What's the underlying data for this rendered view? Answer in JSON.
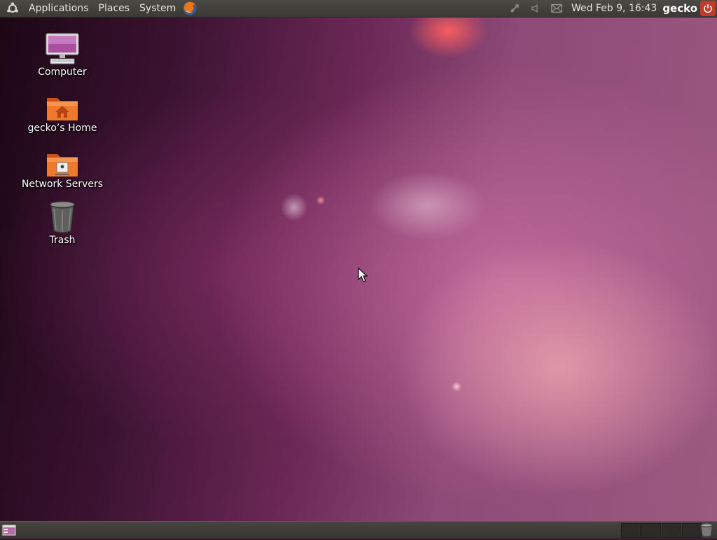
{
  "top_panel": {
    "menus": [
      "Applications",
      "Places",
      "System"
    ],
    "clock": "Wed Feb  9, 16:43",
    "user": "gecko",
    "icons": [
      "ubuntu-logo-icon",
      "firefox-icon",
      "network-icon",
      "volume-icon",
      "mail-icon",
      "power-icon"
    ]
  },
  "desktop": {
    "icons": [
      {
        "label": "Computer",
        "icon": "computer-icon"
      },
      {
        "label": "gecko’s Home",
        "icon": "home-folder-icon"
      },
      {
        "label": "Network Servers",
        "icon": "network-folder-icon"
      },
      {
        "label": "Trash",
        "icon": "trash-icon"
      }
    ]
  },
  "bottom_panel": {
    "workspace_count": 4,
    "icons": [
      "show-desktop-icon",
      "trash-applet-icon"
    ]
  },
  "colors": {
    "panel": "#3c3b37",
    "folder_orange": "#e9691c",
    "power_red": "#c13a2c"
  }
}
